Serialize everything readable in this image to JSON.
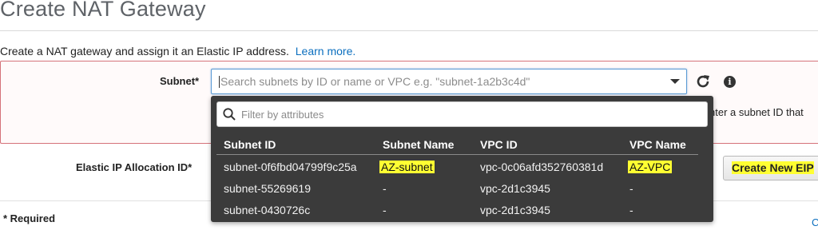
{
  "page": {
    "title": "Create NAT Gateway",
    "intro": "Create a NAT gateway and assign it an Elastic IP address.",
    "learn_more": "Learn more."
  },
  "subnet_field": {
    "label": "Subnet*",
    "placeholder": "Search subnets by ID or name or VPC e.g. \"subnet-1a2b3c4d\"",
    "refresh_icon": "refresh-icon",
    "info_icon": "info-icon",
    "info_glyph": "i",
    "obscured_help_text": "nter a subnet ID that"
  },
  "dropdown": {
    "filter_placeholder": "Filter by attributes",
    "columns": [
      "Subnet ID",
      "Subnet Name",
      "VPC ID",
      "VPC Name"
    ],
    "rows": [
      {
        "subnet_id": "subnet-0f6fbd04799f9c25a",
        "subnet_name": "AZ-subnet",
        "vpc_id": "vpc-0c06afd352760381d",
        "vpc_name": "AZ-VPC"
      },
      {
        "subnet_id": "subnet-55269619",
        "subnet_name": "-",
        "vpc_id": "vpc-2d1c3945",
        "vpc_name": "-"
      },
      {
        "subnet_id": "subnet-0430726c",
        "subnet_name": "-",
        "vpc_id": "vpc-2d1c3945",
        "vpc_name": "-"
      }
    ]
  },
  "eip_field": {
    "label": "Elastic IP Allocation ID*",
    "create_button": "Create New EIP"
  },
  "footer": {
    "required": "* Required",
    "corner_link": "C"
  },
  "colors": {
    "highlight": "#ffff32",
    "error_border": "#d5727a",
    "dropdown_bg": "#3b3b3b",
    "link": "#0b6fbf"
  }
}
